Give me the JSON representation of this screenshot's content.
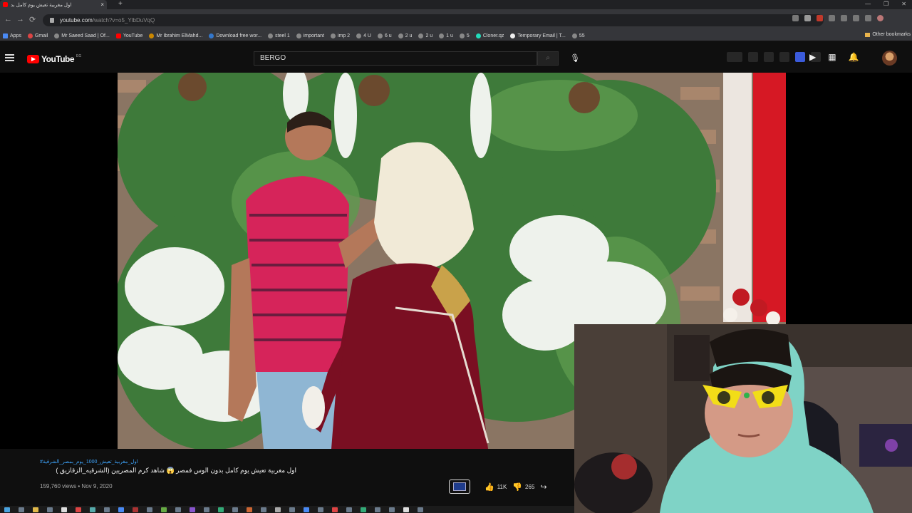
{
  "browser": {
    "tab_title": "اول مغربية تعيش يوم كامل بد",
    "new_tab_symbol": "+",
    "window_controls": [
      "—",
      "❐",
      "✕"
    ],
    "url_host": "youtube.com",
    "url_path": "/watch?v=o5_YlbDuVqQ",
    "bookmarks": [
      "Apps",
      "Gmail",
      "Mr Saeed Saad | Of...",
      "YouTube",
      "Mr Ibrahim ElMahd...",
      "Download free wor...",
      "steel 1",
      "important",
      "imp 2",
      "4 U",
      "6 u",
      "2 u",
      "2 u",
      "1 u",
      "5",
      "Cloner.qz",
      "Temporary Email | T...",
      "55"
    ],
    "other_bookmarks": "Other bookmarks"
  },
  "youtube": {
    "logo_text": "YouTube",
    "logo_country": "EG",
    "search_value": "BERGO",
    "video": {
      "hashtags": "#اول_مغربية_تعيش_1000_يوم_بمصر_الشرقية",
      "title": "اول مغربية تعيش يوم كامل بدون الوس فمصر 😱 شاهد كرم المصريين (الشرقيه_الزقازيق )",
      "views": "159,760 views",
      "date": "Nov 9, 2020",
      "likes": "11K",
      "dislikes": "265"
    }
  },
  "colors": {
    "accent": "#ff0000",
    "link": "#3ea6ff",
    "shirt": "#d6245a",
    "dress": "#7a0f22",
    "hoodie": "#7fd3c6"
  }
}
